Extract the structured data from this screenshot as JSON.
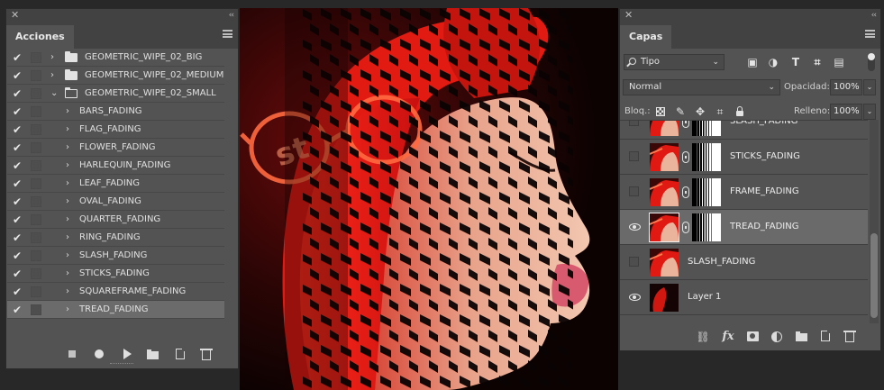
{
  "actions_panel": {
    "tab_label": "Acciones",
    "close_glyph": "✕",
    "collapse_glyph": "‹‹",
    "items": [
      {
        "label": "GEOMETRIC_WIPE_02_BIG",
        "kind": "set",
        "expanded": false,
        "checked": true
      },
      {
        "label": "GEOMETRIC_WIPE_02_MEDIUM",
        "kind": "set",
        "expanded": false,
        "checked": true
      },
      {
        "label": "GEOMETRIC_WIPE_02_SMALL",
        "kind": "set",
        "expanded": true,
        "checked": true
      },
      {
        "label": "BARS_FADING",
        "kind": "action",
        "checked": true
      },
      {
        "label": "FLAG_FADING",
        "kind": "action",
        "checked": true
      },
      {
        "label": "FLOWER_FADING",
        "kind": "action",
        "checked": true
      },
      {
        "label": "HARLEQUIN_FADING",
        "kind": "action",
        "checked": true
      },
      {
        "label": "LEAF_FADING",
        "kind": "action",
        "checked": true
      },
      {
        "label": "OVAL_FADING",
        "kind": "action",
        "checked": true
      },
      {
        "label": "QUARTER_FADING",
        "kind": "action",
        "checked": true
      },
      {
        "label": "RING_FADING",
        "kind": "action",
        "checked": true
      },
      {
        "label": "SLASH_FADING",
        "kind": "action",
        "checked": true
      },
      {
        "label": "STICKS_FADING",
        "kind": "action",
        "checked": true
      },
      {
        "label": "SQUAREFRAME_FADING",
        "kind": "action",
        "checked": true
      },
      {
        "label": "TREAD_FADING",
        "kind": "action",
        "checked": true,
        "selected": true
      }
    ],
    "footer_icons": [
      "stop-icon",
      "record-icon",
      "play-icon",
      "new-set-folder-icon",
      "new-action-icon",
      "trash-icon"
    ]
  },
  "canvas": {
    "description_icon": "photo-canvas"
  },
  "layers_panel": {
    "tab_label": "Capas",
    "close_glyph": "✕",
    "collapse_glyph": "‹‹",
    "filter_kind": "Tipo",
    "filter_icons": [
      "image-filter-icon",
      "adjustment-filter-icon",
      "type-filter-icon",
      "shape-filter-icon",
      "smart-object-filter-icon"
    ],
    "blend_mode": "Normal",
    "opacity_label": "Opacidad:",
    "opacity_value": "100%",
    "lock_label": "Bloq.:",
    "fill_label": "Relleno:",
    "fill_value": "100%",
    "layers": [
      {
        "name": "SLASH_FADING",
        "visible": false,
        "has_mask": true,
        "linked": true
      },
      {
        "name": "STICKS_FADING",
        "visible": false,
        "has_mask": true,
        "linked": true
      },
      {
        "name": "FRAME_FADING",
        "visible": false,
        "has_mask": true,
        "linked": true
      },
      {
        "name": "TREAD_FADING",
        "visible": true,
        "has_mask": true,
        "linked": true,
        "active": true
      },
      {
        "name": "SLASH_FADING",
        "visible": false,
        "has_mask": false,
        "linked": false
      },
      {
        "name": "Layer 1",
        "visible": true,
        "has_mask": false,
        "linked": false,
        "dark_thumb": true
      }
    ],
    "footer_icons": [
      "link-layers-icon",
      "fx-icon",
      "add-mask-icon",
      "adjustment-layer-icon",
      "new-group-icon",
      "new-layer-icon",
      "trash-icon"
    ],
    "fx_label": "fx"
  },
  "colors": {
    "panel_bg": "#535353",
    "panel_header": "#424242",
    "selected_row": "#6b6b6b",
    "canvas_red": "#e01b1b"
  }
}
